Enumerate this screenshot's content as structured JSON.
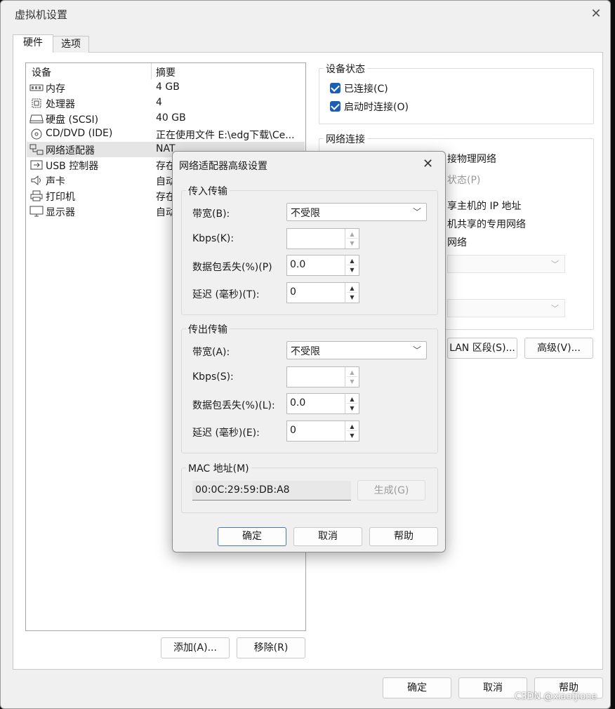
{
  "main_window": {
    "title": "虚拟机设置",
    "tabs": [
      {
        "label": "硬件"
      },
      {
        "label": "选项"
      }
    ],
    "device_list": {
      "col_device": "设备",
      "col_summary": "摘要",
      "rows": [
        {
          "name": "内存",
          "summary": "4 GB",
          "icon": "memory-icon"
        },
        {
          "name": "处理器",
          "summary": "4",
          "icon": "processor-icon"
        },
        {
          "name": "硬盘 (SCSI)",
          "summary": "40 GB",
          "icon": "harddisk-icon"
        },
        {
          "name": "CD/DVD (IDE)",
          "summary": "正在使用文件 E:\\edg下载\\Ce...",
          "icon": "cd-dvd-icon"
        },
        {
          "name": "网络适配器",
          "summary": "NAT",
          "icon": "network-adapter-icon"
        },
        {
          "name": "USB 控制器",
          "summary": "存在",
          "icon": "usb-icon"
        },
        {
          "name": "声卡",
          "summary": "自动",
          "icon": "sound-card-icon"
        },
        {
          "name": "打印机",
          "summary": "存在",
          "icon": "printer-icon"
        },
        {
          "name": "显示器",
          "summary": "自动",
          "icon": "display-icon"
        }
      ]
    },
    "add_button": "添加(A)...",
    "remove_button": "移除(R)",
    "device_status": {
      "title": "设备状态",
      "connected": "已连接(C)",
      "connect_on_start": "启动时连接(O)"
    },
    "network_connection": {
      "title": "网络连接",
      "bridged_partial": "接物理网络",
      "replicate_partial": "状态(P)",
      "nat_partial": "享主机的 IP 地址",
      "hostonly_partial": "机共享的专用网络",
      "custom_partial": "网络"
    },
    "lan_segment_button": "LAN 区段(S)...",
    "advanced_button": "高级(V)...",
    "ok_button": "确定",
    "cancel_button": "取消",
    "help_button": "帮助"
  },
  "adv_dialog": {
    "title": "网络适配器高级设置",
    "incoming": {
      "title": "传入传输",
      "bandwidth_label": "带宽(B):",
      "bandwidth_value": "不受限",
      "kbps_label": "Kbps(K):",
      "kbps_value": "",
      "loss_label": "数据包丢失(%)(P)",
      "loss_value": "0.0",
      "latency_label": "延迟 (毫秒)(T):",
      "latency_value": "0"
    },
    "outgoing": {
      "title": "传出传输",
      "bandwidth_label": "带宽(A):",
      "bandwidth_value": "不受限",
      "kbps_label": "Kbps(S):",
      "kbps_value": "",
      "loss_label": "数据包丢失(%)(L):",
      "loss_value": "0.0",
      "latency_label": "延迟 (毫秒)(E):",
      "latency_value": "0"
    },
    "mac": {
      "title": "MAC 地址(M)",
      "value": "00:0C:29:59:DB:A8",
      "generate_button": "生成(G)"
    },
    "ok_button": "确定",
    "cancel_button": "取消",
    "help_button": "帮助"
  },
  "watermark": "CSDN @xiaofjione",
  "colors": {
    "accent": "#1a5fb4",
    "selection": "#e5e5e5"
  }
}
